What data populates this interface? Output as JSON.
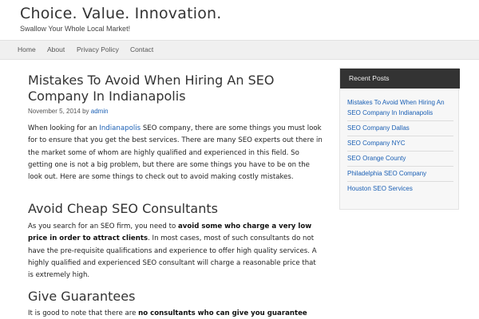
{
  "site": {
    "title": "Choice. Value. Innovation.",
    "tagline": "Swallow Your Whole Local Market!"
  },
  "nav": {
    "items": [
      {
        "label": "Home"
      },
      {
        "label": "About"
      },
      {
        "label": "Privacy Policy"
      },
      {
        "label": "Contact"
      }
    ]
  },
  "post": {
    "title": "Mistakes To Avoid When Hiring An SEO Company In Indianapolis",
    "meta": {
      "date": "November 5, 2014",
      "by": "by",
      "author": "admin"
    },
    "intro": {
      "before_link": "When looking for an ",
      "link": "Indianapolis",
      "after_link": " SEO company, there are some things you must look for to ensure that you get the best services. There are many SEO experts out there in the market some of whom are highly qualified and experienced in this field. So getting one is not a big problem, but there are some things you have to be on the look out. Here are some things to check out to avoid making costly mistakes."
    },
    "section1": {
      "heading": "Avoid Cheap SEO Consultants",
      "before_bold": "As you search for an SEO firm, you need to ",
      "bold": "avoid some who charge a very low price in order to attract clients",
      "after_bold": ". In most cases, most of such consultants do not have the pre-requisite qualifications and experience to offer high quality services. A highly qualified and experienced SEO consultant will charge a reasonable price that is extremely high."
    },
    "section2": {
      "heading": "Give Guarantees",
      "before_bold": "It is good to note that there are ",
      "bold": "no consultants who can give you guarantee"
    }
  },
  "sidebar": {
    "widget_title": "Recent Posts",
    "recent_posts": [
      {
        "label": "Mistakes To Avoid When Hiring An SEO Company In Indianapolis"
      },
      {
        "label": "SEO Company Dallas"
      },
      {
        "label": "SEO Company NYC"
      },
      {
        "label": "SEO Orange County"
      },
      {
        "label": "Philadelphia SEO Company"
      },
      {
        "label": "Houston SEO Services"
      }
    ]
  }
}
